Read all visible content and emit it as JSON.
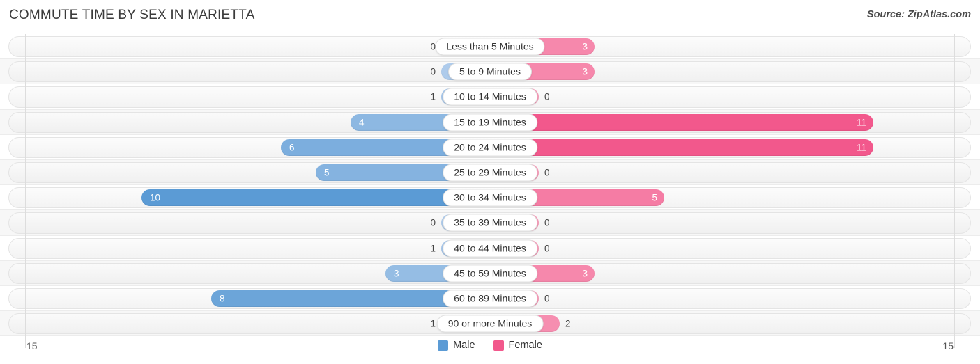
{
  "header": {
    "title": "COMMUTE TIME BY SEX IN MARIETTA",
    "source": "Source: ZipAtlas.com"
  },
  "legend": {
    "male_label": "Male",
    "female_label": "Female",
    "male_color": "#5b9bd5",
    "female_color": "#f2588c"
  },
  "axis": {
    "left_tick": "15",
    "right_tick": "15"
  },
  "chart_data": {
    "type": "bar",
    "subtype": "diverging-bidirectional",
    "title": "COMMUTE TIME BY SEX IN MARIETTA",
    "xlabel": "",
    "ylabel": "",
    "xlim": [
      15,
      15
    ],
    "grid": false,
    "legend_position": "bottom-center",
    "categories": [
      "Less than 5 Minutes",
      "5 to 9 Minutes",
      "10 to 14 Minutes",
      "15 to 19 Minutes",
      "20 to 24 Minutes",
      "25 to 29 Minutes",
      "30 to 34 Minutes",
      "35 to 39 Minutes",
      "40 to 44 Minutes",
      "45 to 59 Minutes",
      "60 to 89 Minutes",
      "90 or more Minutes"
    ],
    "series": [
      {
        "name": "Male",
        "values": [
          0,
          0,
          1,
          4,
          6,
          5,
          10,
          0,
          1,
          3,
          8,
          1
        ]
      },
      {
        "name": "Female",
        "values": [
          3,
          3,
          0,
          11,
          11,
          0,
          5,
          0,
          0,
          3,
          0,
          2
        ]
      }
    ]
  },
  "rows": [
    {
      "label": "Less than 5 Minutes",
      "male": "0",
      "female": "3"
    },
    {
      "label": "5 to 9 Minutes",
      "male": "0",
      "female": "3"
    },
    {
      "label": "10 to 14 Minutes",
      "male": "1",
      "female": "0"
    },
    {
      "label": "15 to 19 Minutes",
      "male": "4",
      "female": "11"
    },
    {
      "label": "20 to 24 Minutes",
      "male": "6",
      "female": "11"
    },
    {
      "label": "25 to 29 Minutes",
      "male": "5",
      "female": "0"
    },
    {
      "label": "30 to 34 Minutes",
      "male": "10",
      "female": "5"
    },
    {
      "label": "35 to 39 Minutes",
      "male": "0",
      "female": "0"
    },
    {
      "label": "40 to 44 Minutes",
      "male": "1",
      "female": "0"
    },
    {
      "label": "45 to 59 Minutes",
      "male": "3",
      "female": "3"
    },
    {
      "label": "60 to 89 Minutes",
      "male": "8",
      "female": "0"
    },
    {
      "label": "90 or more Minutes",
      "male": "1",
      "female": "2"
    }
  ]
}
